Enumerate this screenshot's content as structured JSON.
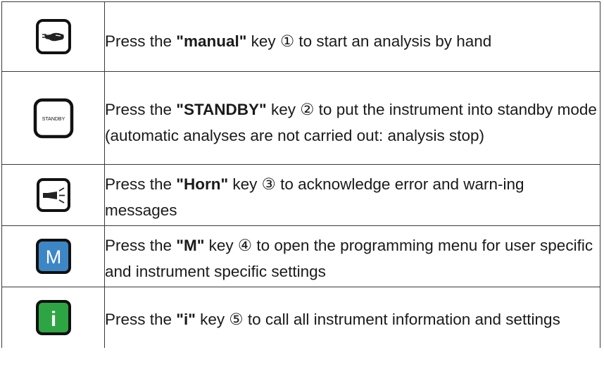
{
  "rows": [
    {
      "icon": "hand-icon",
      "key_label": "",
      "pre": "Press the ",
      "key": "\"manual\"",
      "circled": "①",
      "post": " to start an analysis by hand"
    },
    {
      "icon": "standby-key-icon",
      "key_label": "STANDBY",
      "pre": "Press the ",
      "key": "\"STANDBY\"",
      "circled": "②",
      "post": " to put the instrument into standby mode (automatic analyses are not carried out: analysis stop)"
    },
    {
      "icon": "horn-icon",
      "key_label": "",
      "pre": "Press the ",
      "key": "\"Horn\"",
      "circled": "③",
      "post": " to acknowledge error and warn-ing messages"
    },
    {
      "icon": "m-key-icon",
      "key_label": "M",
      "pre": "Press the ",
      "key": "\"M\"",
      "circled": "④",
      "post": " to open the programming menu for user specific and instrument specific settings"
    },
    {
      "icon": "info-key-icon",
      "key_label": "i",
      "pre": "Press the ",
      "key": "\"i\"",
      "circled": "⑤",
      "post": " to call all instrument information and settings"
    }
  ],
  "colors": {
    "m_key_fill": "#3d86c6",
    "i_key_fill": "#2ea543",
    "key_border": "#111111"
  },
  "common": {
    "key_word": " key "
  }
}
